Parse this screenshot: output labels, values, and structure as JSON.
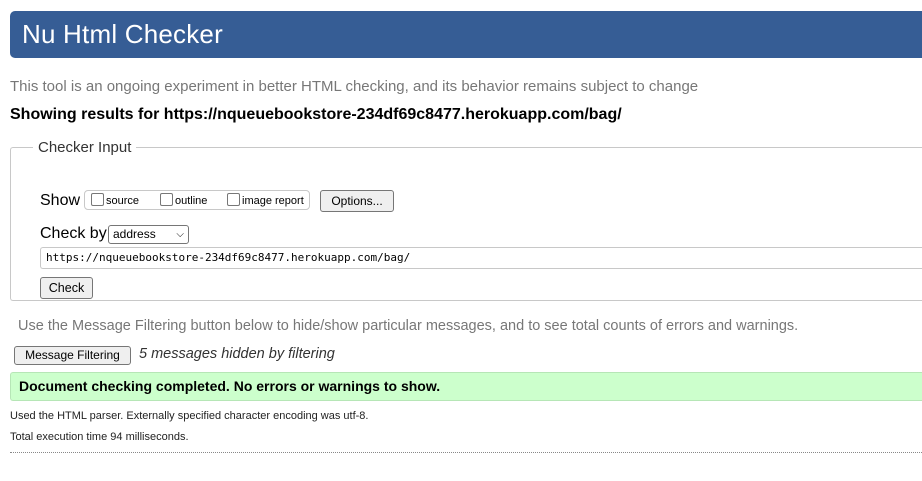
{
  "header": {
    "title": "Nu Html Checker"
  },
  "subtitle": "This tool is an ongoing experiment in better HTML checking, and its behavior remains subject to change",
  "results_heading": "Showing results for https://nqueuebookstore-234df69c8477.herokuapp.com/bag/",
  "checker_input": {
    "legend": "Checker Input",
    "show_label": "Show",
    "show_options": [
      {
        "label": "source",
        "checked": false
      },
      {
        "label": "outline",
        "checked": false
      },
      {
        "label": "image report",
        "checked": false
      }
    ],
    "options_button": "Options...",
    "check_by_label": "Check by",
    "check_by_selected": "address",
    "url_value": "https://nqueuebookstore-234df69c8477.herokuapp.com/bag/",
    "check_button": "Check"
  },
  "filter": {
    "info": "Use the Message Filtering button below to hide/show particular messages, and to see total counts of errors and warnings.",
    "button": "Message Filtering",
    "hidden_text": "5 messages hidden by filtering"
  },
  "success_message": "Document checking completed. No errors or warnings to show.",
  "parser_info": "Used the HTML parser. Externally specified character encoding was utf-8.",
  "execution_time": "Total execution time 94 milliseconds.",
  "colors": {
    "header_bg": "#365d95",
    "success_bg": "#ccffcc"
  }
}
